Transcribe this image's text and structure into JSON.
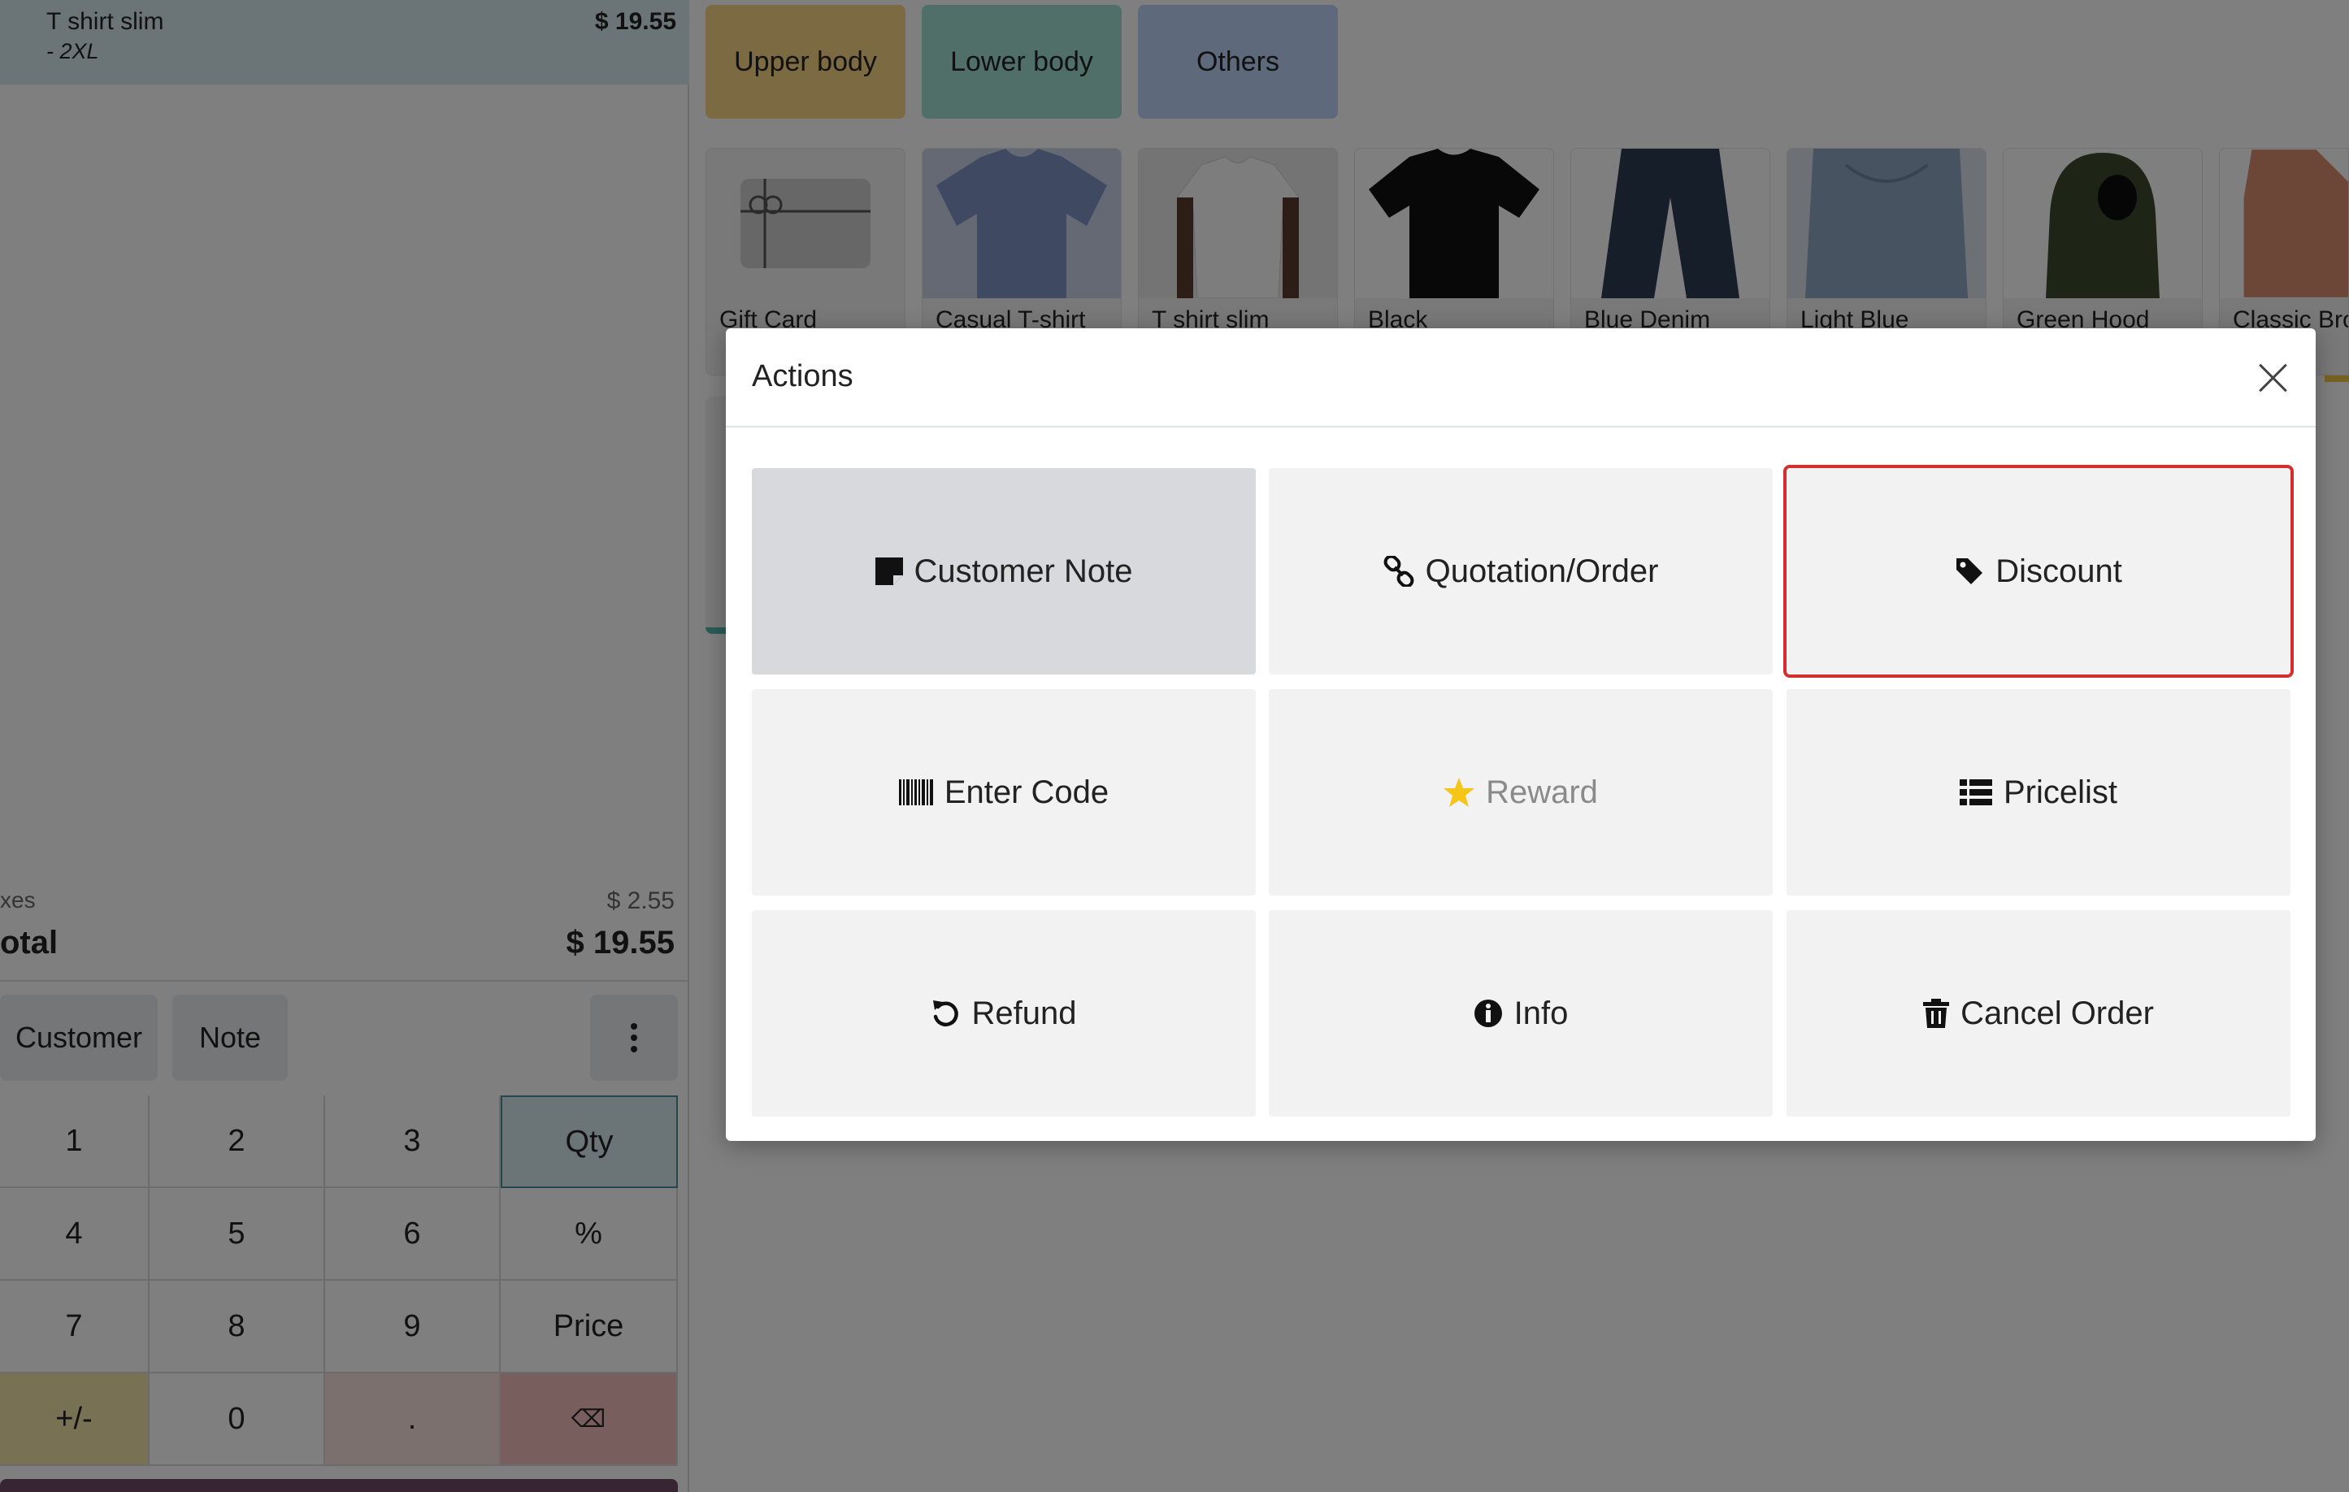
{
  "order": {
    "line": {
      "name": "T shirt slim",
      "price": "$ 19.55",
      "variant": "- 2XL"
    },
    "taxes_label": "xes",
    "taxes_value": "$ 2.55",
    "total_label": "otal",
    "total_value": "$ 19.55"
  },
  "controls": {
    "customer_label": "Customer",
    "note_label": "Note",
    "more_icon": "kebab-vertical-icon"
  },
  "numpad": {
    "keys": [
      "1",
      "2",
      "3",
      "Qty",
      "4",
      "5",
      "6",
      "%",
      "7",
      "8",
      "9",
      "Price",
      "+/-",
      "0",
      ".",
      "⌫"
    ]
  },
  "categories": [
    {
      "label": "Upper body",
      "color": "#f6d584"
    },
    {
      "label": "Lower body",
      "color": "#a2ded2"
    },
    {
      "label": "Others",
      "color": "#bcd3f7"
    }
  ],
  "products": [
    "Gift Card",
    "Casual T-shirt",
    "T shirt slim",
    "Black",
    "Blue Denim",
    "Light Blue",
    "Green Hood",
    "Classic Bro"
  ],
  "dialog": {
    "title": "Actions",
    "close_icon": "close-icon",
    "actions": [
      {
        "label": "Customer Note",
        "icon": "sticky-note-icon"
      },
      {
        "label": "Quotation/Order",
        "icon": "link-icon"
      },
      {
        "label": "Discount",
        "icon": "tag-icon"
      },
      {
        "label": "Enter Code",
        "icon": "barcode-icon"
      },
      {
        "label": "Reward",
        "icon": "star-icon"
      },
      {
        "label": "Pricelist",
        "icon": "list-icon"
      },
      {
        "label": "Refund",
        "icon": "undo-icon"
      },
      {
        "label": "Info",
        "icon": "info-circle-icon"
      },
      {
        "label": "Cancel Order",
        "icon": "trash-icon"
      }
    ]
  },
  "colors": {
    "highlight_outline": "#d32f2f",
    "reward_star": "#f5c518",
    "pay_button": "#714b67"
  }
}
